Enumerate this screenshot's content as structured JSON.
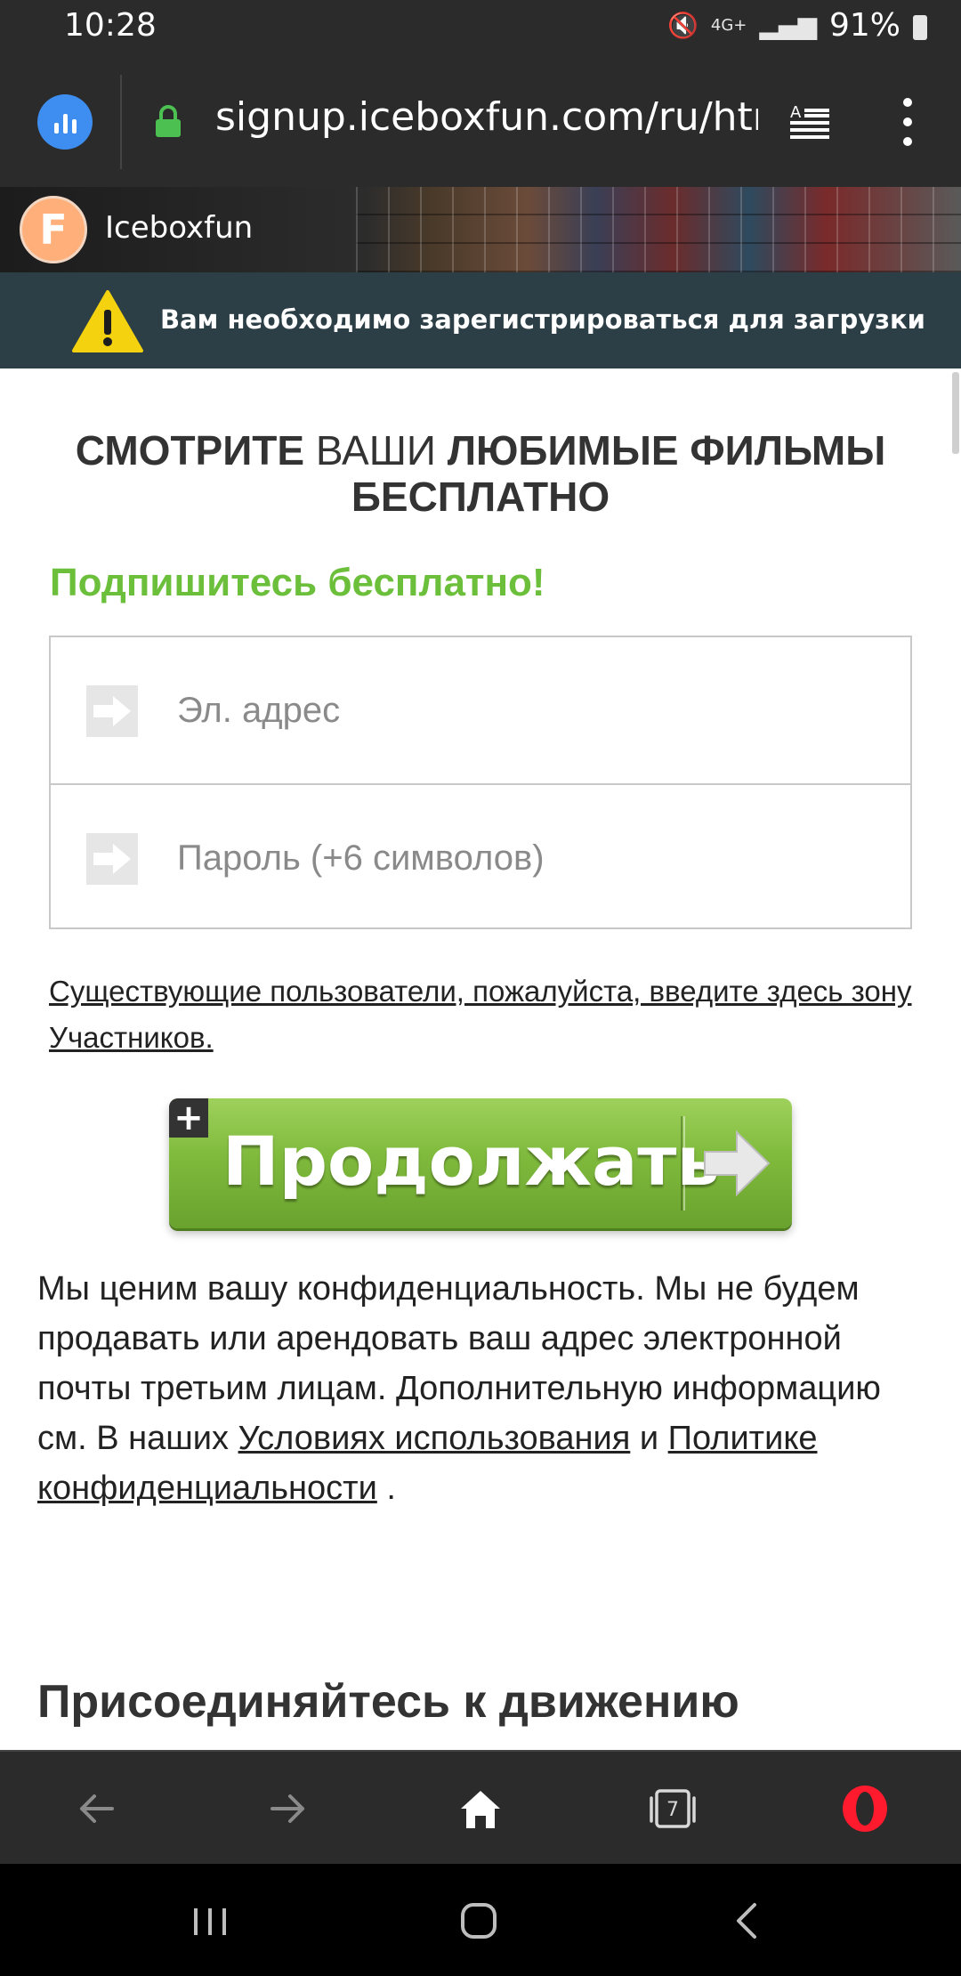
{
  "status_bar": {
    "time": "10:28",
    "signal_label": "4G+",
    "battery": "91%"
  },
  "browser": {
    "url": "signup.iceboxfun.com/ru/htm",
    "icons": {
      "speed_dial": "bar-chart-icon",
      "secure": "lock-icon",
      "reader_mode": "reader-icon",
      "menu": "more-vertical-icon"
    }
  },
  "site": {
    "logo_letter": "F",
    "brand": "Iceboxfun"
  },
  "banner": {
    "text": "Вам необходимо зарегистрироваться для загрузки",
    "icon": "warning-icon"
  },
  "headline": {
    "part1": "СМОТРИТЕ",
    "part2": " ВАШИ ",
    "part3": "ЛЮБИМЫЕ ФИЛЬМЫ БЕСПЛАТНО"
  },
  "subhead": "Подпишитесь бесплатно!",
  "form": {
    "email_placeholder": "Эл. адрес",
    "email_value": "",
    "password_placeholder": "Пароль (+6 символов)",
    "password_value": ""
  },
  "member_link": "Существующие пользователи, пожалуйста, введите здесь зону Участников.",
  "continue_button": {
    "plus": "+",
    "label": "Продолжать"
  },
  "privacy": {
    "text": "Мы ценим вашу конфиденциальность. Мы не будем продавать или арендовать ваш адрес электронной почты третьим лицам. Дополнительную информацию см. В наших ",
    "terms_link": "Условиях использования",
    "and": " и ",
    "privacy_link": "Политике конфиденциальности",
    "end": " ."
  },
  "join_heading": "Присоединяйтесь к движению",
  "toolbar": {
    "tab_count": "7",
    "icons": [
      "back-icon",
      "forward-icon",
      "home-icon",
      "tabs-icon",
      "opera-icon"
    ]
  },
  "colors": {
    "accent_green": "#6bbf3a",
    "banner_bg": "#2c3e46",
    "button_green": "#7fba3c",
    "opera_red": "#ff1b2d"
  }
}
